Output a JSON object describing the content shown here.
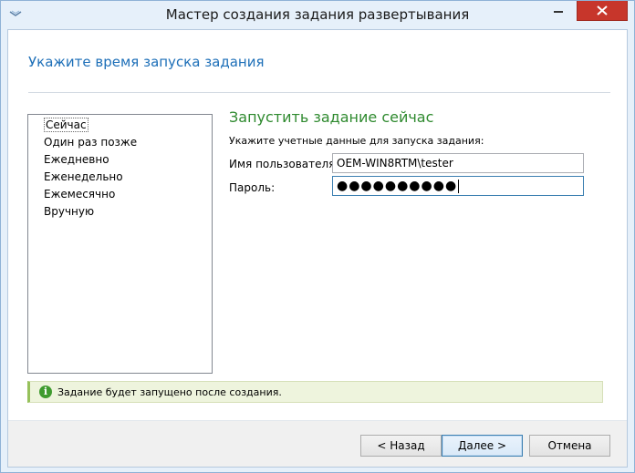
{
  "window": {
    "title": "Мастер создания задания развертывания"
  },
  "header": {
    "title": "Укажите время запуска задания"
  },
  "schedule": {
    "items": [
      {
        "label": "Сейчас",
        "selected": true
      },
      {
        "label": "Один раз позже",
        "selected": false
      },
      {
        "label": "Ежедневно",
        "selected": false
      },
      {
        "label": "Еженедельно",
        "selected": false
      },
      {
        "label": "Ежемесячно",
        "selected": false
      },
      {
        "label": "Вручную",
        "selected": false
      }
    ]
  },
  "panel": {
    "title": "Запустить задание сейчас",
    "subtitle": "Укажите учетные данные для запуска задания:",
    "username_label": "Имя пользователя:",
    "username_value": "OEM-WIN8RTM\\tester",
    "password_label": "Пароль:",
    "password_mask": "●●●●●●●●●●"
  },
  "info": {
    "icon": "info-icon",
    "text": "Задание будет запущено после создания."
  },
  "buttons": {
    "back": "< Назад",
    "next": "Далее >",
    "cancel": "Отмена"
  },
  "colors": {
    "header_title": "#1d6fb8",
    "section_title": "#2f8a2f",
    "close_button": "#c7362b",
    "info_icon": "#3f9b2f"
  }
}
